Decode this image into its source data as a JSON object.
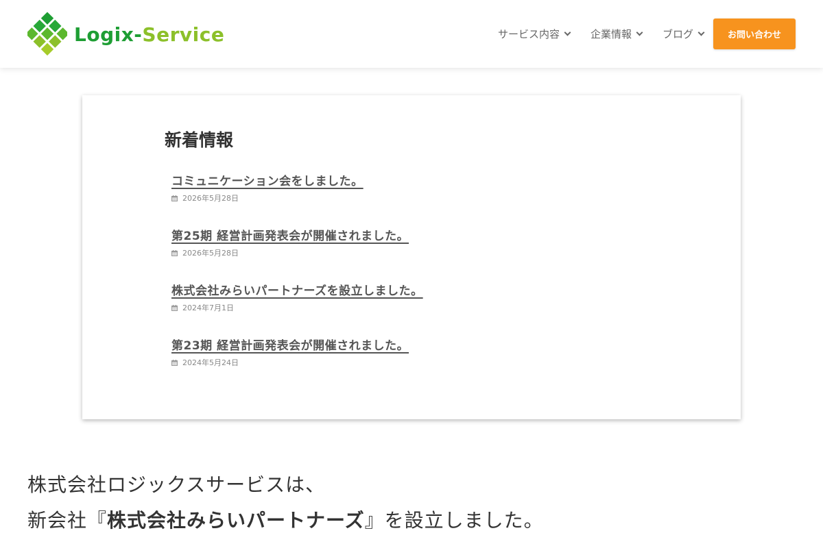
{
  "header": {
    "logo_text_1": "Logix-",
    "logo_text_2": "Service",
    "nav": [
      {
        "label": "サービス内容",
        "icon": "chevron-down-icon"
      },
      {
        "label": "企業情報",
        "icon": "chevron-down-icon"
      },
      {
        "label": "ブログ",
        "icon": "chevron-down-icon"
      }
    ],
    "contact_label": "お問い合わせ"
  },
  "news": {
    "title": "新着情報",
    "items": [
      {
        "title": "コミュニケーション会をしました。",
        "date": "2026年5月28日"
      },
      {
        "title": "第25期 経営計画発表会が開催されました。",
        "date": "2026年5月28日"
      },
      {
        "title": "株式会社みらいパートナーズを設立しました。",
        "date": "2024年7月1日"
      },
      {
        "title": "第23期 経営計画発表会が開催されました。",
        "date": "2024年5月24日"
      }
    ]
  },
  "intro": {
    "line1": "株式会社ロジックスサービスは、",
    "line2_pre": "新会社『",
    "line2_bold": "株式会社みらいパートナーズ",
    "line2_post": "』を設立しました。"
  },
  "colors": {
    "accent": "#f7931e",
    "logo_green_dark": "#1e9e34",
    "logo_green_light": "#8cc02a"
  }
}
